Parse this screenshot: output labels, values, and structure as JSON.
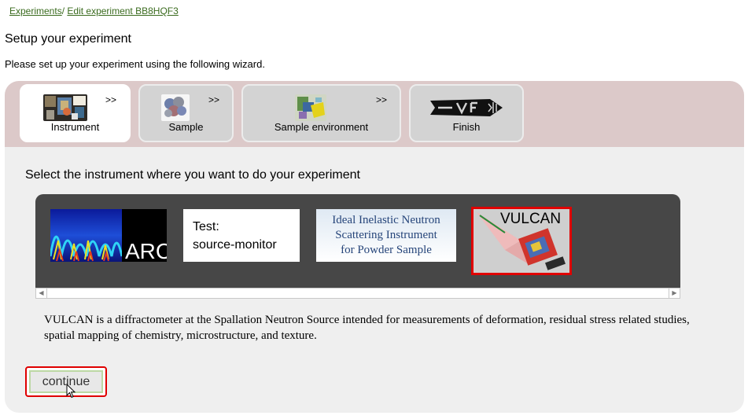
{
  "breadcrumb": {
    "root": "Experiments",
    "separator": "/",
    "current": "Edit experiment BB8HQF3"
  },
  "page_title": "Setup your experiment",
  "intro": "Please set up your experiment using the following wizard.",
  "wizard": {
    "tabs": [
      {
        "label": "Instrument",
        "arrow": ">>",
        "icon": "instrument-photo-icon",
        "active": true
      },
      {
        "label": "Sample",
        "arrow": ">>",
        "icon": "atom-cluster-icon",
        "active": false
      },
      {
        "label": "Sample environment",
        "arrow": ">>",
        "icon": "sample-environment-icon",
        "active": false
      },
      {
        "label": "Finish",
        "arrow": "",
        "icon": "finish-logo-icon",
        "active": false
      }
    ]
  },
  "instrument_step": {
    "prompt": "Select the instrument where you want to do your experiment",
    "instruments": [
      {
        "name": "ARCS",
        "selected": false
      },
      {
        "name_line1": "Test:",
        "name_line2": "source-monitor",
        "selected": false
      },
      {
        "line1": "Ideal Inelastic Neutron",
        "line2": "Scattering Instrument",
        "line3": "for Powder Sample",
        "selected": false
      },
      {
        "name": "VULCAN",
        "selected": true
      }
    ],
    "description": "VULCAN is a diffractometer at the Spallation Neutron Source intended for measurements of deformation, residual stress related studies, spatial mapping of chemistry, microstructure, and texture.",
    "continue_label": "continue"
  },
  "colors": {
    "link": "#3a6b1e",
    "selection": "#e00000",
    "tabbar": "#dcc9c9",
    "panel": "#efefef",
    "carousel": "#474747"
  }
}
